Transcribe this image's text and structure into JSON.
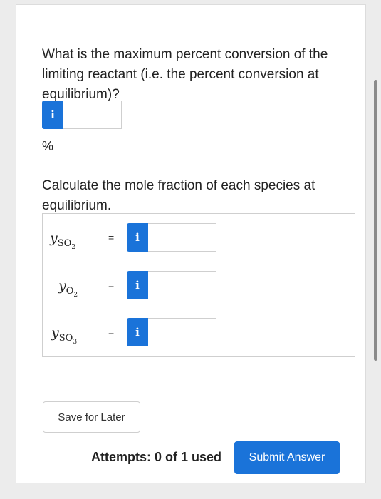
{
  "question1": {
    "text": "What is the maximum percent conversion of the limiting reactant (i.e. the percent conversion at equilibrium)?",
    "info_icon": "i",
    "input_value": "",
    "unit": "%"
  },
  "question2": {
    "text": "Calculate the mole fraction of each species at equilibrium.",
    "rows": [
      {
        "var": "y",
        "sub": "SO",
        "sub2": "2",
        "eq": "=",
        "info_icon": "i",
        "input_value": ""
      },
      {
        "var": "y",
        "sub": "O",
        "sub2": "2",
        "eq": "=",
        "info_icon": "i",
        "input_value": ""
      },
      {
        "var": "y",
        "sub": "SO",
        "sub2": "3",
        "eq": "=",
        "info_icon": "i",
        "input_value": ""
      }
    ]
  },
  "actions": {
    "save_label": "Save for Later",
    "attempts_text": "Attempts: 0 of 1 used",
    "submit_label": "Submit Answer"
  },
  "colors": {
    "accent": "#1a73d9"
  }
}
